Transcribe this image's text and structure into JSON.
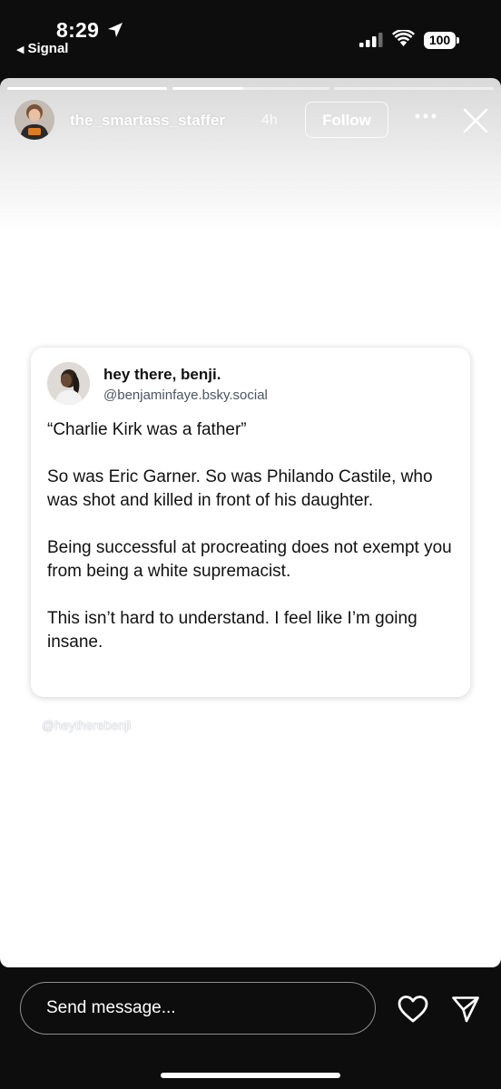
{
  "status_bar": {
    "time": "8:29",
    "back_app": "Signal",
    "battery": "100"
  },
  "story": {
    "progress": [
      1.0,
      0.45,
      0.0
    ],
    "username": "the_smartass_staffer",
    "time_ago": "4h",
    "follow_label": "Follow"
  },
  "post": {
    "display_name": "hey there, benji.",
    "handle": "@benjaminfaye.bsky.social",
    "paragraphs": [
      "“Charlie Kirk was a father”",
      "So was Eric Garner. So was Philando Castile, who was shot and killed in front of his daughter.",
      "Being successful at procreating does not exempt you from being a white supremacist.",
      "This isn’t hard to understand. I feel like I’m going insane."
    ]
  },
  "watermark": "@heytherebenji",
  "footer": {
    "message_placeholder": "Send message..."
  },
  "colors": {
    "background": "#0d0d0d",
    "story_bg": "#ffffff",
    "handle_gray": "#4b5563"
  }
}
